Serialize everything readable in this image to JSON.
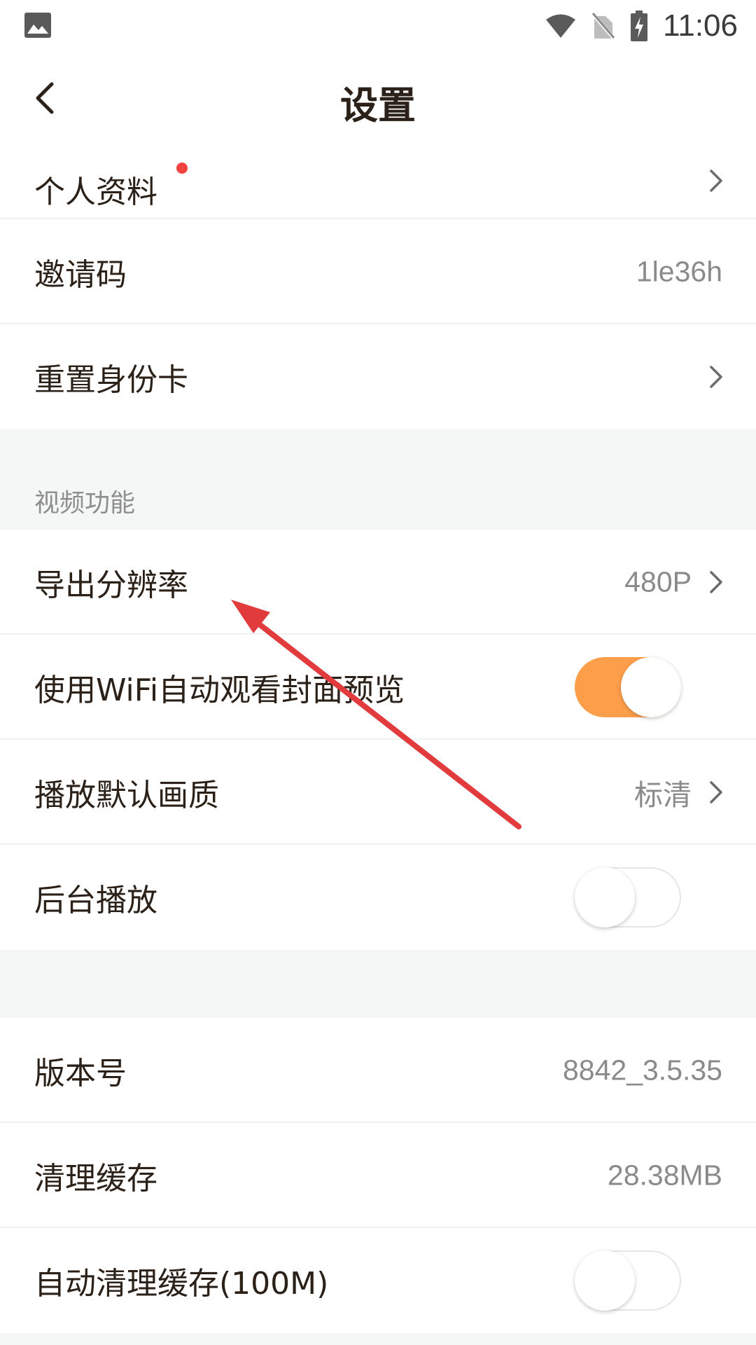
{
  "status_bar": {
    "time": "11:06",
    "icons": [
      "image-icon",
      "wifi-icon",
      "no-sim-icon",
      "battery-charging-icon"
    ]
  },
  "header": {
    "title": "设置",
    "back_icon": "chevron-left-icon"
  },
  "account": {
    "profile_label": "个人资料",
    "invite_label": "邀请码",
    "invite_value": "1le36h",
    "reset_card_label": "重置身份卡"
  },
  "video": {
    "section_title": "视频功能",
    "export_resolution_label": "导出分辨率",
    "export_resolution_value": "480P",
    "wifi_preview_label": "使用WiFi自动观看封面预览",
    "wifi_preview_on": true,
    "default_quality_label": "播放默认画质",
    "default_quality_value": "标清",
    "background_play_label": "后台播放",
    "background_play_on": false
  },
  "about": {
    "version_label": "版本号",
    "version_value": "8842_3.5.35",
    "clear_cache_label": "清理缓存",
    "clear_cache_value": "28.38MB",
    "auto_clear_label": "自动清理缓存(100M)",
    "auto_clear_on": false
  },
  "colors": {
    "accent": "#fd9e4a",
    "badge_red": "#f3433e",
    "annotation_arrow": "#e23b3d",
    "text_primary": "#2b2119",
    "text_secondary": "#8a8a8a",
    "section_bg": "#f5f6f6"
  }
}
